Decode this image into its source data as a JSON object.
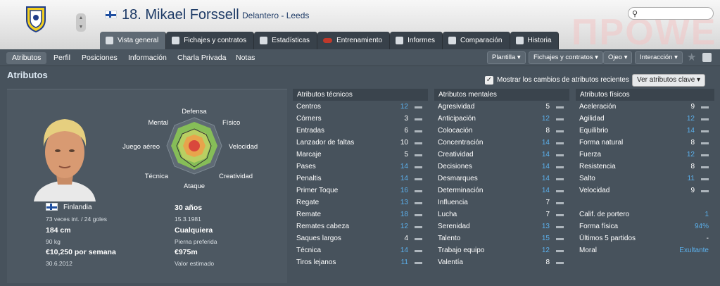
{
  "header": {
    "watermark": "ΠPOWE",
    "player_name": "18. Mikael Forssell",
    "player_position": "Delantero - Leeds"
  },
  "tabs": [
    {
      "label": "Vista general",
      "icon": "overview-icon",
      "active": true
    },
    {
      "label": "Fichajes y contratos",
      "icon": "contract-icon"
    },
    {
      "label": "Estadísticas",
      "icon": "stats-icon"
    },
    {
      "label": "Entrenamiento",
      "icon": "training-icon"
    },
    {
      "label": "Informes",
      "icon": "report-icon"
    },
    {
      "label": "Comparación",
      "icon": "compare-icon"
    },
    {
      "label": "Historia",
      "icon": "history-icon"
    }
  ],
  "subnav": {
    "items": [
      "Atributos",
      "Perfil",
      "Posiciones",
      "Información",
      "Charla Privada",
      "Notas"
    ],
    "dropdowns": [
      "Plantilla ▾",
      "Fichajes y contratos ▾",
      "Ojeo ▾",
      "Interacción ▾"
    ]
  },
  "section": {
    "title": "Atributos",
    "checkbox_label": "Mostrar los cambios de atributos recientes",
    "key_button": "Ver atributos clave"
  },
  "radar": {
    "labels": [
      "Defensa",
      "Físico",
      "Velocidad",
      "Creatividad",
      "Ataque",
      "Técnica",
      "Juego aéreo",
      "Mental"
    ]
  },
  "profile": {
    "nationality": "Finlandia",
    "caps": "73 veces int. / 24 goles",
    "age": "30 años",
    "dob": "15.3.1981",
    "height": "184 cm",
    "foot": "Cualquiera",
    "weight": "90 kg",
    "foot_label": "Pierna preferida",
    "wage": "€10,250 por semana",
    "value": "€975m",
    "contract_end": "30.6.2012",
    "value_label": "Valor estimado"
  },
  "technical": {
    "title": "Atributos técnicos",
    "rows": [
      {
        "name": "Centros",
        "value": "12",
        "hi": true
      },
      {
        "name": "Córners",
        "value": "3"
      },
      {
        "name": "Entradas",
        "value": "6"
      },
      {
        "name": "Lanzador de faltas",
        "value": "10"
      },
      {
        "name": "Marcaje",
        "value": "5"
      },
      {
        "name": "Pases",
        "value": "14",
        "hi": true
      },
      {
        "name": "Penaltis",
        "value": "14",
        "hi": true
      },
      {
        "name": "Primer Toque",
        "value": "16",
        "hi": true
      },
      {
        "name": "Regate",
        "value": "13",
        "hi": true
      },
      {
        "name": "Remate",
        "value": "18",
        "hi": true
      },
      {
        "name": "Remates cabeza",
        "value": "12",
        "hi": true
      },
      {
        "name": "Saques largos",
        "value": "4"
      },
      {
        "name": "Técnica",
        "value": "14",
        "hi": true
      },
      {
        "name": "Tiros lejanos",
        "value": "11",
        "hi": true
      }
    ]
  },
  "mental": {
    "title": "Atributos mentales",
    "rows": [
      {
        "name": "Agresividad",
        "value": "5"
      },
      {
        "name": "Anticipación",
        "value": "12",
        "hi": true
      },
      {
        "name": "Colocación",
        "value": "8"
      },
      {
        "name": "Concentración",
        "value": "14",
        "hi": true
      },
      {
        "name": "Creatividad",
        "value": "14",
        "hi": true
      },
      {
        "name": "Decisiones",
        "value": "14",
        "hi": true
      },
      {
        "name": "Desmarques",
        "value": "14",
        "hi": true
      },
      {
        "name": "Determinación",
        "value": "14",
        "hi": true
      },
      {
        "name": "Influencia",
        "value": "7"
      },
      {
        "name": "Lucha",
        "value": "7"
      },
      {
        "name": "Serenidad",
        "value": "13",
        "hi": true
      },
      {
        "name": "Talento",
        "value": "15",
        "hi": true
      },
      {
        "name": "Trabajo equipo",
        "value": "12",
        "hi": true
      },
      {
        "name": "Valentía",
        "value": "8"
      }
    ]
  },
  "physical": {
    "title": "Atributos físicos",
    "rows": [
      {
        "name": "Aceleración",
        "value": "9"
      },
      {
        "name": "Agilidad",
        "value": "12",
        "hi": true
      },
      {
        "name": "Equilibrio",
        "value": "14",
        "hi": true
      },
      {
        "name": "Forma natural",
        "value": "8"
      },
      {
        "name": "Fuerza",
        "value": "12",
        "hi": true
      },
      {
        "name": "Resistencia",
        "value": "8"
      },
      {
        "name": "Salto",
        "value": "11",
        "hi": true
      },
      {
        "name": "Velocidad",
        "value": "9"
      }
    ],
    "extra": [
      {
        "name": "Calif. de portero",
        "value": "1",
        "hi": true
      },
      {
        "name": "Forma física",
        "value": "94%",
        "hi": true
      },
      {
        "name": "Últimos 5 partidos",
        "value": "-"
      },
      {
        "name": "Moral",
        "value": "Exultante",
        "hi": true
      }
    ]
  },
  "colors": {
    "highlight": "#5bb0ec",
    "panel": "#4d5862",
    "header_text": "#1d3a66"
  }
}
